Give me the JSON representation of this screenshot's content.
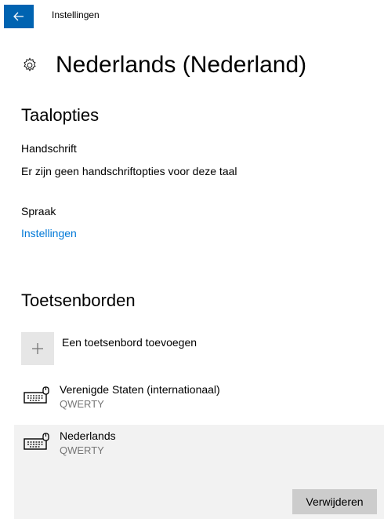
{
  "window": {
    "title": "Instellingen"
  },
  "page": {
    "title": "Nederlands (Nederland)"
  },
  "language_options": {
    "title": "Taalopties",
    "handwriting_label": "Handschrift",
    "handwriting_text": "Er zijn geen handschriftopties voor deze taal",
    "speech_label": "Spraak",
    "speech_link": "Instellingen"
  },
  "keyboards": {
    "title": "Toetsenborden",
    "add_label": "Een toetsenbord toevoegen",
    "items": [
      {
        "name": "Verenigde Staten (internationaal)",
        "layout": "QWERTY"
      },
      {
        "name": "Nederlands",
        "layout": "QWERTY"
      }
    ],
    "remove_label": "Verwijderen"
  },
  "colors": {
    "accent": "#0063b1",
    "link": "#0078d7",
    "selected_bg": "#f2f2f2"
  }
}
